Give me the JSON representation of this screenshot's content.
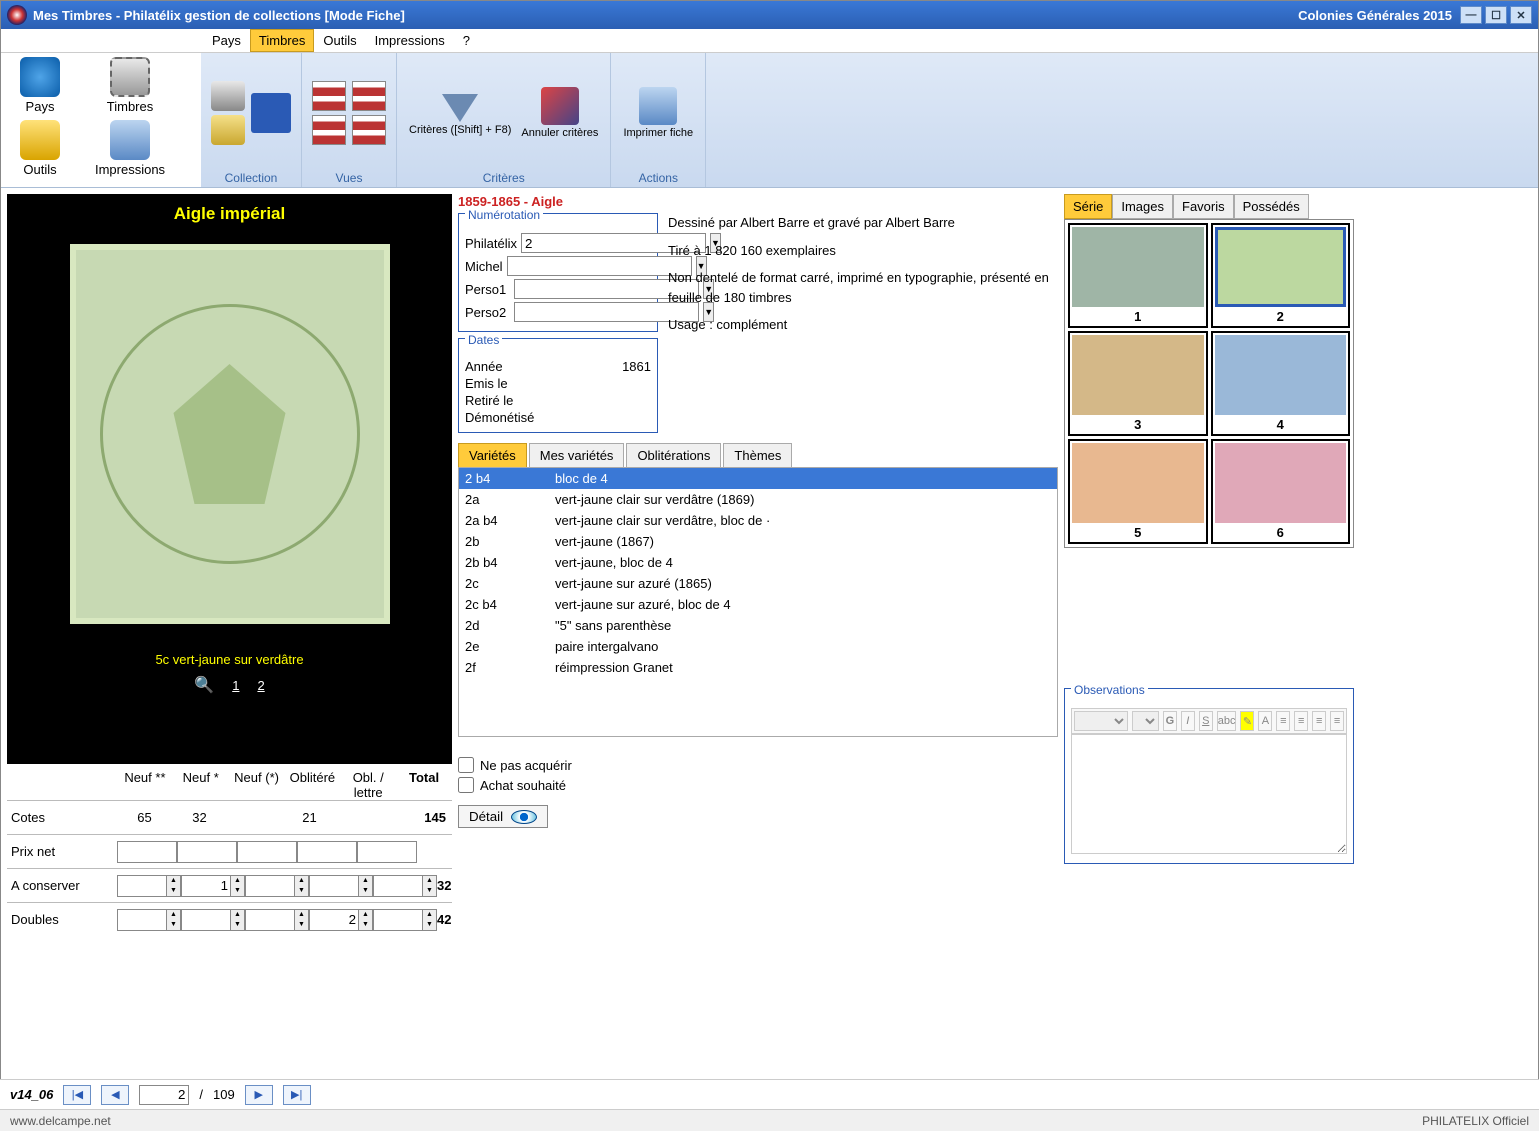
{
  "window": {
    "title_left": "Mes Timbres - Philatélix gestion de collections [Mode Fiche]",
    "title_right": "Colonies Générales 2015"
  },
  "menubar": {
    "items": [
      "Pays",
      "Timbres",
      "Outils",
      "Impressions",
      "?"
    ],
    "active_index": 1
  },
  "sidebar": {
    "pays": "Pays",
    "timbres": "Timbres",
    "outils": "Outils",
    "impressions": "Impressions"
  },
  "ribbon": {
    "collection": {
      "label": "Collection"
    },
    "vues": {
      "label": "Vues"
    },
    "criteres": {
      "label": "Critères",
      "btn1": "Critères ([Shift] + F8)",
      "btn2": "Annuler critères"
    },
    "actions": {
      "label": "Actions",
      "btn1": "Imprimer fiche"
    }
  },
  "stamp": {
    "title": "Aigle impérial",
    "caption": "5c vert-jaune sur verdâtre",
    "pages": [
      "1",
      "2"
    ]
  },
  "series_header": "1859-1865 - Aigle",
  "numerotation": {
    "legend": "Numérotation",
    "philatelix": {
      "label": "Philatélix",
      "value": "2"
    },
    "michel": {
      "label": "Michel",
      "value": ""
    },
    "perso1": {
      "label": "Perso1",
      "value": ""
    },
    "perso2": {
      "label": "Perso2",
      "value": ""
    }
  },
  "description": {
    "l1": "Dessiné par Albert Barre et gravé par Albert Barre",
    "l2": "Tiré à 1 820 160 exemplaires",
    "l3": "Non dentelé de format carré, imprimé en typographie, présenté en feuille de 180 timbres",
    "l4": "Usage : complément"
  },
  "dates": {
    "legend": "Dates",
    "annee": {
      "label": "Année",
      "value": "1861"
    },
    "emis": {
      "label": "Emis le",
      "value": ""
    },
    "retire": {
      "label": "Retiré le",
      "value": ""
    },
    "demonetise": {
      "label": "Démonétisé",
      "value": ""
    }
  },
  "var_tabs": {
    "items": [
      "Variétés",
      "Mes variétés",
      "Oblitérations",
      "Thèmes"
    ],
    "active_index": 0
  },
  "varieties": [
    {
      "code": "2 b4",
      "desc": "bloc de 4",
      "selected": true
    },
    {
      "code": "2a",
      "desc": "vert-jaune clair sur verdâtre (1869)"
    },
    {
      "code": "2a b4",
      "desc": "vert-jaune clair sur verdâtre, bloc de ·"
    },
    {
      "code": "2b",
      "desc": "vert-jaune (1867)"
    },
    {
      "code": "2b b4",
      "desc": "vert-jaune, bloc de 4"
    },
    {
      "code": "2c",
      "desc": "vert-jaune sur azuré (1865)"
    },
    {
      "code": "2c b4",
      "desc": "vert-jaune sur azuré, bloc de 4"
    },
    {
      "code": "2d",
      "desc": "\"5\" sans parenthèse"
    },
    {
      "code": "2e",
      "desc": "paire intergalvano"
    },
    {
      "code": "2f",
      "desc": "réimpression Granet"
    }
  ],
  "options": {
    "ne_pas_acquerir": "Ne pas acquérir",
    "achat_souhaite": "Achat souhaité",
    "detail": "Détail"
  },
  "r_tabs": {
    "items": [
      "Série",
      "Images",
      "Favoris",
      "Possédés"
    ],
    "active_index": 0
  },
  "thumbs": [
    "1",
    "2",
    "3",
    "4",
    "5",
    "6"
  ],
  "observations": {
    "legend": "Observations"
  },
  "prices": {
    "headers": {
      "lbl": "",
      "c1": "Neuf **",
      "c2": "Neuf *",
      "c3": "Neuf (*)",
      "c4": "Oblitéré",
      "c5": "Obl. / lettre",
      "total": "Total"
    },
    "cotes": {
      "label": "Cotes",
      "v1": "65",
      "v2": "32",
      "v3": "",
      "v4": "21",
      "v5": "",
      "total": "145"
    },
    "prixnet": {
      "label": "Prix net"
    },
    "aconserver": {
      "label": "A conserver",
      "v1": "",
      "v2": "1",
      "v3": "",
      "v4": "",
      "v5": "",
      "total": "32"
    },
    "doubles": {
      "label": "Doubles",
      "v1": "",
      "v2": "",
      "v3": "",
      "v4": "2",
      "v5": "",
      "total": "42"
    }
  },
  "footer": {
    "version": "v14_06",
    "page": "2",
    "total": "109",
    "sep": "/"
  },
  "bottom": {
    "left": "www.delcampe.net",
    "right": "PHILATELIX Officiel"
  }
}
